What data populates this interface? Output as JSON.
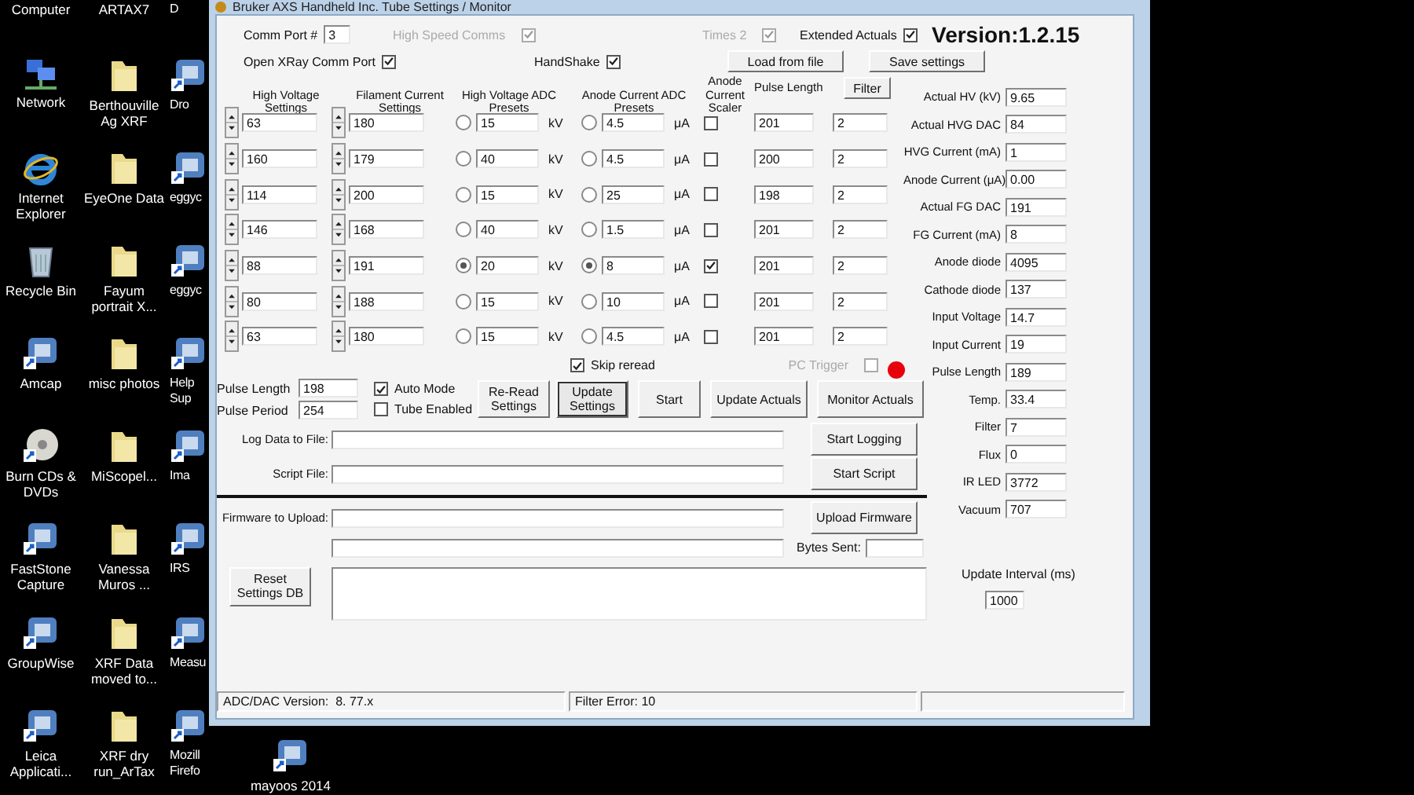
{
  "desktop": {
    "columns": [
      [
        {
          "label": "Computer",
          "kind": "none"
        },
        {
          "label": "Network",
          "kind": "network"
        },
        {
          "label": "Internet Explorer",
          "kind": "browser"
        },
        {
          "label": "Recycle Bin",
          "kind": "bin"
        },
        {
          "label": "Amcap",
          "kind": "app"
        },
        {
          "label": "Burn CDs & DVDs",
          "kind": "disc"
        },
        {
          "label": "FastStone Capture",
          "kind": "app"
        },
        {
          "label": "GroupWise",
          "kind": "app"
        },
        {
          "label": "Leica Applicati...",
          "kind": "app"
        }
      ],
      [
        {
          "label": "ARTAX7",
          "kind": "none"
        },
        {
          "label": "Berthouville Ag XRF",
          "kind": "folder"
        },
        {
          "label": "EyeOne Data",
          "kind": "folder"
        },
        {
          "label": "Fayum portrait X...",
          "kind": "folder"
        },
        {
          "label": "misc photos",
          "kind": "folder"
        },
        {
          "label": "MiScopel...",
          "kind": "folder"
        },
        {
          "label": "Vanessa Muros ...",
          "kind": "folder"
        },
        {
          "label": "XRF Data moved to...",
          "kind": "folder"
        },
        {
          "label": "XRF dry run_ArTax",
          "kind": "folder"
        }
      ],
      [
        {
          "label": "D",
          "kind": "none"
        },
        {
          "label": "Dro",
          "kind": "app"
        },
        {
          "label": "eggyc",
          "kind": "app"
        },
        {
          "label": "eggyc",
          "kind": "app"
        },
        {
          "label": "Help Sup",
          "kind": "app"
        },
        {
          "label": "Ima",
          "kind": "app"
        },
        {
          "label": "IRS",
          "kind": "app"
        },
        {
          "label": "Measu",
          "kind": "app"
        },
        {
          "label": "Mozill Firefo",
          "kind": "app"
        }
      ],
      [
        {
          "label": "mayoos 2014",
          "kind": "app"
        }
      ]
    ]
  },
  "window": {
    "title": "Bruker AXS Handheld Inc. Tube Settings / Monitor"
  },
  "header": {
    "comm_port_label": "Comm Port #",
    "comm_port": "3",
    "options": [
      {
        "label": "High Speed Comms",
        "checked": true,
        "disabled": true
      },
      {
        "label": "Times 2",
        "checked": true,
        "disabled": true
      },
      {
        "label": "Extended Actuals",
        "checked": true,
        "disabled": false
      }
    ],
    "version": "Version:1.2.15",
    "open_port": {
      "label": "Open XRay Comm Port",
      "checked": true
    },
    "handshake": {
      "label": "HandShake",
      "checked": true
    },
    "buttons": [
      "Load from file",
      "Save settings"
    ]
  },
  "presets": {
    "columns": [
      "High Voltage Settings",
      "Filament Current Settings",
      "High Voltage ADC Presets",
      "Anode Current ADC Presets",
      "Anode Current Scaler",
      "Pulse Length"
    ],
    "filter_button": "Filter",
    "rows": [
      {
        "hv_setting": "63",
        "filament": "180",
        "hv_preset": "15",
        "hv_selected": false,
        "hv_unit": "kV",
        "anode_preset": "4.5",
        "anode_selected": false,
        "anode_unit": "μA",
        "scaler": false,
        "pulse_length": "201",
        "filter": "2"
      },
      {
        "hv_setting": "160",
        "filament": "179",
        "hv_preset": "40",
        "hv_selected": false,
        "hv_unit": "kV",
        "anode_preset": "4.5",
        "anode_selected": false,
        "anode_unit": "μA",
        "scaler": false,
        "pulse_length": "200",
        "filter": "2"
      },
      {
        "hv_setting": "114",
        "filament": "200",
        "hv_preset": "15",
        "hv_selected": false,
        "hv_unit": "kV",
        "anode_preset": "25",
        "anode_selected": false,
        "anode_unit": "μA",
        "scaler": false,
        "pulse_length": "198",
        "filter": "2"
      },
      {
        "hv_setting": "146",
        "filament": "168",
        "hv_preset": "40",
        "hv_selected": false,
        "hv_unit": "kV",
        "anode_preset": "1.5",
        "anode_selected": false,
        "anode_unit": "μA",
        "scaler": false,
        "pulse_length": "201",
        "filter": "2"
      },
      {
        "hv_setting": "88",
        "filament": "191",
        "hv_preset": "20",
        "hv_selected": true,
        "hv_unit": "kV",
        "anode_preset": "8",
        "anode_selected": true,
        "anode_unit": "μA",
        "scaler": true,
        "pulse_length": "201",
        "filter": "2"
      },
      {
        "hv_setting": "80",
        "filament": "188",
        "hv_preset": "15",
        "hv_selected": false,
        "hv_unit": "kV",
        "anode_preset": "10",
        "anode_selected": false,
        "anode_unit": "μA",
        "scaler": false,
        "pulse_length": "201",
        "filter": "2"
      },
      {
        "hv_setting": "63",
        "filament": "180",
        "hv_preset": "15",
        "hv_selected": false,
        "hv_unit": "kV",
        "anode_preset": "4.5",
        "anode_selected": false,
        "anode_unit": "μA",
        "scaler": false,
        "pulse_length": "201",
        "filter": "2"
      }
    ]
  },
  "skip_reread": {
    "label": "Skip reread",
    "checked": true
  },
  "pc_trigger": {
    "label": "PC Trigger",
    "checked": false,
    "disabled": true
  },
  "pulse_fields": [
    {
      "label": "Pulse Length",
      "value": "198"
    },
    {
      "label": "Pulse Period",
      "value": "254"
    }
  ],
  "modes": [
    {
      "label": "Auto Mode",
      "checked": true
    },
    {
      "label": "Tube Enabled",
      "checked": false
    }
  ],
  "actions": [
    {
      "label": "Re-Read Settings",
      "focused": false
    },
    {
      "label": "Update Settings",
      "focused": true
    },
    {
      "label": "Start",
      "focused": false
    },
    {
      "label": "Update Actuals",
      "focused": false
    },
    {
      "label": "Monitor Actuals",
      "focused": false
    }
  ],
  "files": [
    {
      "label": "Log Data to File:",
      "button": "Start Logging"
    },
    {
      "label": "Script File:",
      "button": "Start Script"
    }
  ],
  "firmware": {
    "label": "Firmware to Upload:",
    "button": "Upload Firmware",
    "bytes_label": "Bytes Sent:",
    "reset_button": "Reset Settings DB"
  },
  "actuals": [
    {
      "label": "Actual HV (kV)",
      "value": "9.65"
    },
    {
      "label": "Actual HVG DAC",
      "value": "84"
    },
    {
      "label": "HVG Current (mA)",
      "value": "1"
    },
    {
      "label": "Anode Current (μA)",
      "value": "0.00"
    },
    {
      "label": "Actual FG DAC",
      "value": "191"
    },
    {
      "label": "FG Current (mA)",
      "value": "8"
    },
    {
      "label": "Anode diode",
      "value": "4095"
    },
    {
      "label": "Cathode diode",
      "value": "137"
    },
    {
      "label": "Input Voltage",
      "value": "14.7"
    },
    {
      "label": "Input Current",
      "value": "19"
    },
    {
      "label": "Pulse Length",
      "value": "189"
    },
    {
      "label": "Temp.",
      "value": "33.4"
    },
    {
      "label": "Filter",
      "value": "7"
    },
    {
      "label": "Flux",
      "value": "0"
    },
    {
      "label": "IR LED",
      "value": "3772"
    },
    {
      "label": "Vacuum",
      "value": "707"
    }
  ],
  "update_interval": {
    "label": "Update Interval (ms)",
    "value": "1000"
  },
  "status_bar": [
    "ADC/DAC Version:  8. 77.x",
    "Filter Error: 10"
  ]
}
